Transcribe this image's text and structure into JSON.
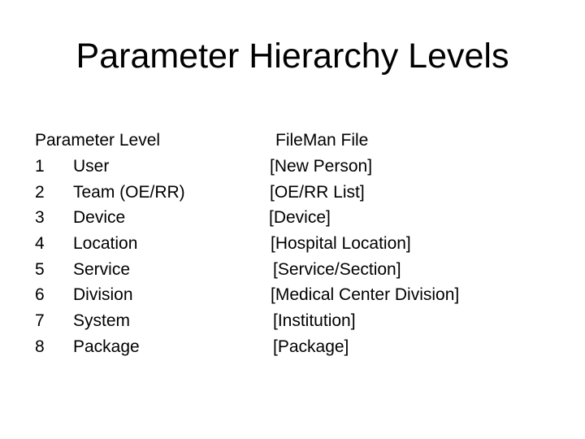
{
  "slide": {
    "title": "Parameter Hierarchy Levels",
    "left_header": "Parameter Level",
    "right_header": "FileMan File",
    "rows": [
      {
        "number": "1",
        "level": "User",
        "file": "[New Person]"
      },
      {
        "number": "2",
        "level": "Team (OE/RR)",
        "file": "[OE/RR List]"
      },
      {
        "number": "3",
        "level": "Device",
        "file": "[Device]"
      },
      {
        "number": "4",
        "level": "Location",
        "file": "[Hospital Location]"
      },
      {
        "number": "5",
        "level": "Service",
        "file": "[Service/Section]"
      },
      {
        "number": "6",
        "level": "Division",
        "file": "[Medical Center Division]"
      },
      {
        "number": "7",
        "level": "System",
        "file": "[Institution]"
      },
      {
        "number": "8",
        "level": "Package",
        "file": "[Package]"
      }
    ]
  }
}
